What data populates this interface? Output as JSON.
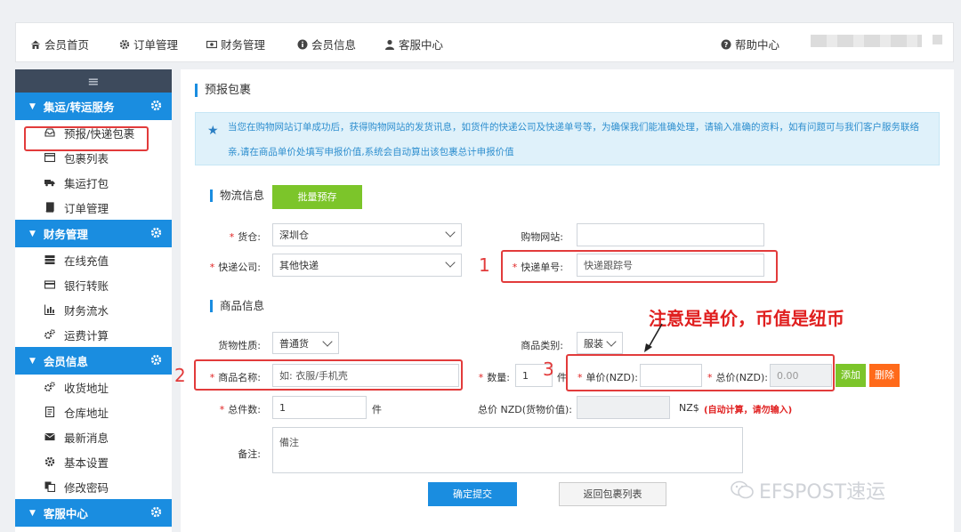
{
  "topnav": {
    "home": "会员首页",
    "orders": "订单管理",
    "finance": "财务管理",
    "member": "会员信息",
    "service": "客服中心",
    "help": "帮助中心"
  },
  "sidebar": {
    "toggle": "≡",
    "groups": [
      {
        "title": "集运/转运服务",
        "items": [
          "预报/快递包裹",
          "包裹列表",
          "集运打包",
          "订单管理"
        ]
      },
      {
        "title": "财务管理",
        "items": [
          "在线充值",
          "银行转账",
          "财务流水",
          "运费计算"
        ]
      },
      {
        "title": "会员信息",
        "items": [
          "收货地址",
          "仓库地址",
          "最新消息",
          "基本设置",
          "修改密码"
        ]
      },
      {
        "title": "客服中心",
        "items": []
      }
    ]
  },
  "page": {
    "title": "预报包裹",
    "notice_line1": "当您在购物网站订单成功后，获得购物网站的发货讯息，如货件的快递公司及快递单号等，为确保我们能准确处理，请输入准确的资料，如有问题可与我们客户服务联络",
    "notice_line2": "亲,请在商品单价处填写申报价值,系统会自动算出该包裹总计申报价值"
  },
  "logistics": {
    "section_title": "物流信息",
    "batch_button": "批量预存",
    "warehouse_label": "货仓:",
    "warehouse_value": "深圳仓",
    "site_label": "购物网站:",
    "site_value": "",
    "courier_label": "快递公司:",
    "courier_value": "其他快递",
    "tracking_label": "快递单号:",
    "tracking_placeholder": "快递跟踪号"
  },
  "goods": {
    "section_title": "商品信息",
    "nature_label": "货物性质:",
    "nature_value": "普通货",
    "category_label": "商品类别:",
    "category_value": "服装",
    "name_label": "商品名称:",
    "name_placeholder": "如: 衣服/手机壳",
    "qty_label": "数量:",
    "qty_value": "1",
    "qty_unit": "件",
    "unit_price_label": "单价(NZD):",
    "unit_price_value": "",
    "total_price_label": "总价(NZD):",
    "total_price_value": "0.00",
    "add_button": "添加",
    "delete_button": "删除",
    "total_pieces_label": "总件数:",
    "total_pieces_value": "1",
    "total_pieces_unit": "件",
    "goods_total_label": "总价 NZD(货物价值):",
    "goods_total_value": "",
    "currency_unit": "NZ$",
    "auto_calc_note": "(自动计算，请勿输入)",
    "remark_label": "备注:",
    "remark_placeholder": "備注",
    "submit_button": "确定提交",
    "back_button": "返回包裹列表"
  },
  "annotations": {
    "n1": "1",
    "n2": "2",
    "n3": "3",
    "note": "注意是单价，币值是纽币"
  },
  "watermark": "EFSPOST速运",
  "colors": {
    "accent": "#1a8de0",
    "sidebar_dark": "#3d4a5c",
    "green": "#7cc52a",
    "orange": "#ff6a1a",
    "annotation_red": "#e23b3b"
  }
}
